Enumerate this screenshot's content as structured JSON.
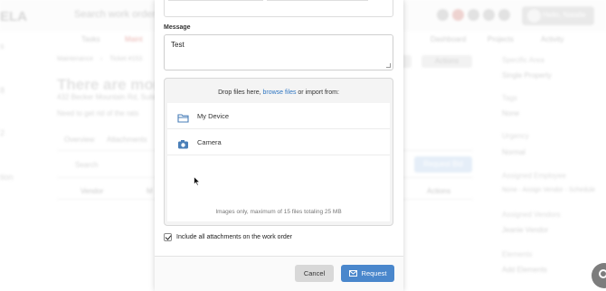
{
  "background": {
    "logo": "ELA",
    "search_placeholder": "Search work orders...",
    "user_name": "Hello, Natalie",
    "nav": [
      "Tasks",
      "Maint",
      "Dashboard",
      "Projects",
      "Activity"
    ],
    "left_items": [
      "s",
      "8",
      "2",
      "tion"
    ],
    "breadcrumb": [
      "Maintenance",
      "Ticket #153"
    ],
    "title": "There are more R",
    "address": "432 Becker Mountain Rd, Suite",
    "description": "Need to get rid of the rats",
    "tabs": [
      "Overview",
      "Attachments"
    ],
    "search_label": "Search",
    "table_headers": [
      "Vendor",
      "M",
      "Actions"
    ],
    "request_bid": "Request Bid",
    "actions_label": "Actions",
    "right_panel": {
      "specific_area_label": "Specific Area",
      "specific_area_value": "Single Property",
      "tags_label": "Tags",
      "tags_value": "None",
      "urgency_label": "Urgency",
      "urgency_value": "Normal",
      "assigned_employee_label": "Assigned Employee",
      "assigned_employee_value": "None - Assign Vendor - Schedule",
      "assigned_vendors_label": "Assigned Vendors",
      "assigned_vendors_value": "Jeanie Vendor",
      "elements_label": "Elements",
      "elements_value": "Add Elements"
    }
  },
  "modal": {
    "message_label": "Message",
    "message_value": "Test",
    "upload": {
      "prompt_before": "Drop files here, ",
      "prompt_link": "browse files",
      "prompt_after": " or import from:",
      "sources": [
        {
          "label": "My Device",
          "icon": "folder-icon"
        },
        {
          "label": "Camera",
          "icon": "camera-icon"
        }
      ],
      "note": "Images only, maximum of 15 files totaling 25 MB"
    },
    "include_attachments_label": "Include all attachments on the work order",
    "include_attachments_checked": true,
    "cancel_label": "Cancel",
    "request_label": "Request"
  },
  "colors": {
    "primary": "#4a87cc",
    "link": "#2f76c2",
    "cancel_bg": "#d8d8d8"
  }
}
